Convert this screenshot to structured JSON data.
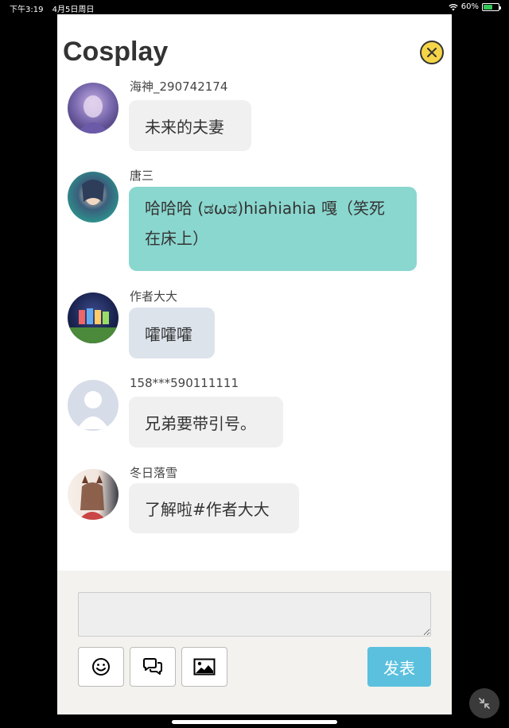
{
  "status_bar": {
    "time": "下午3:19",
    "date": "4月5日周日",
    "battery_percent": 60
  },
  "modal": {
    "title": "Cosplay",
    "close_icon": "close-icon"
  },
  "messages": [
    {
      "sender": "海神_290742174",
      "text": "未来的夫妻",
      "bubble_color": "#f0f0f0"
    },
    {
      "sender": "唐三",
      "text_lines": [
        "哈哈哈 (ಡωಡ)hiahiahia 嘎（笑死",
        "在床上）"
      ],
      "bubble_color": "#8ad7cf"
    },
    {
      "sender": "作者大大",
      "text": "嚯嚯嚯",
      "bubble_color": "#dce3eb"
    },
    {
      "sender": "158***590111111",
      "text": "兄弟要带引号。",
      "bubble_color": "#f0f0f0"
    },
    {
      "sender": "冬日落雪",
      "text": "了解啦#作者大大",
      "bubble_color": "#f0f0f0"
    }
  ],
  "composer": {
    "input_value": "",
    "tools": [
      "emoji-icon",
      "chat-bubbles-icon",
      "image-icon"
    ],
    "send_label": "发表",
    "send_color": "#5bc0de"
  },
  "system": {
    "minimize_icon": "minimize-icon"
  }
}
